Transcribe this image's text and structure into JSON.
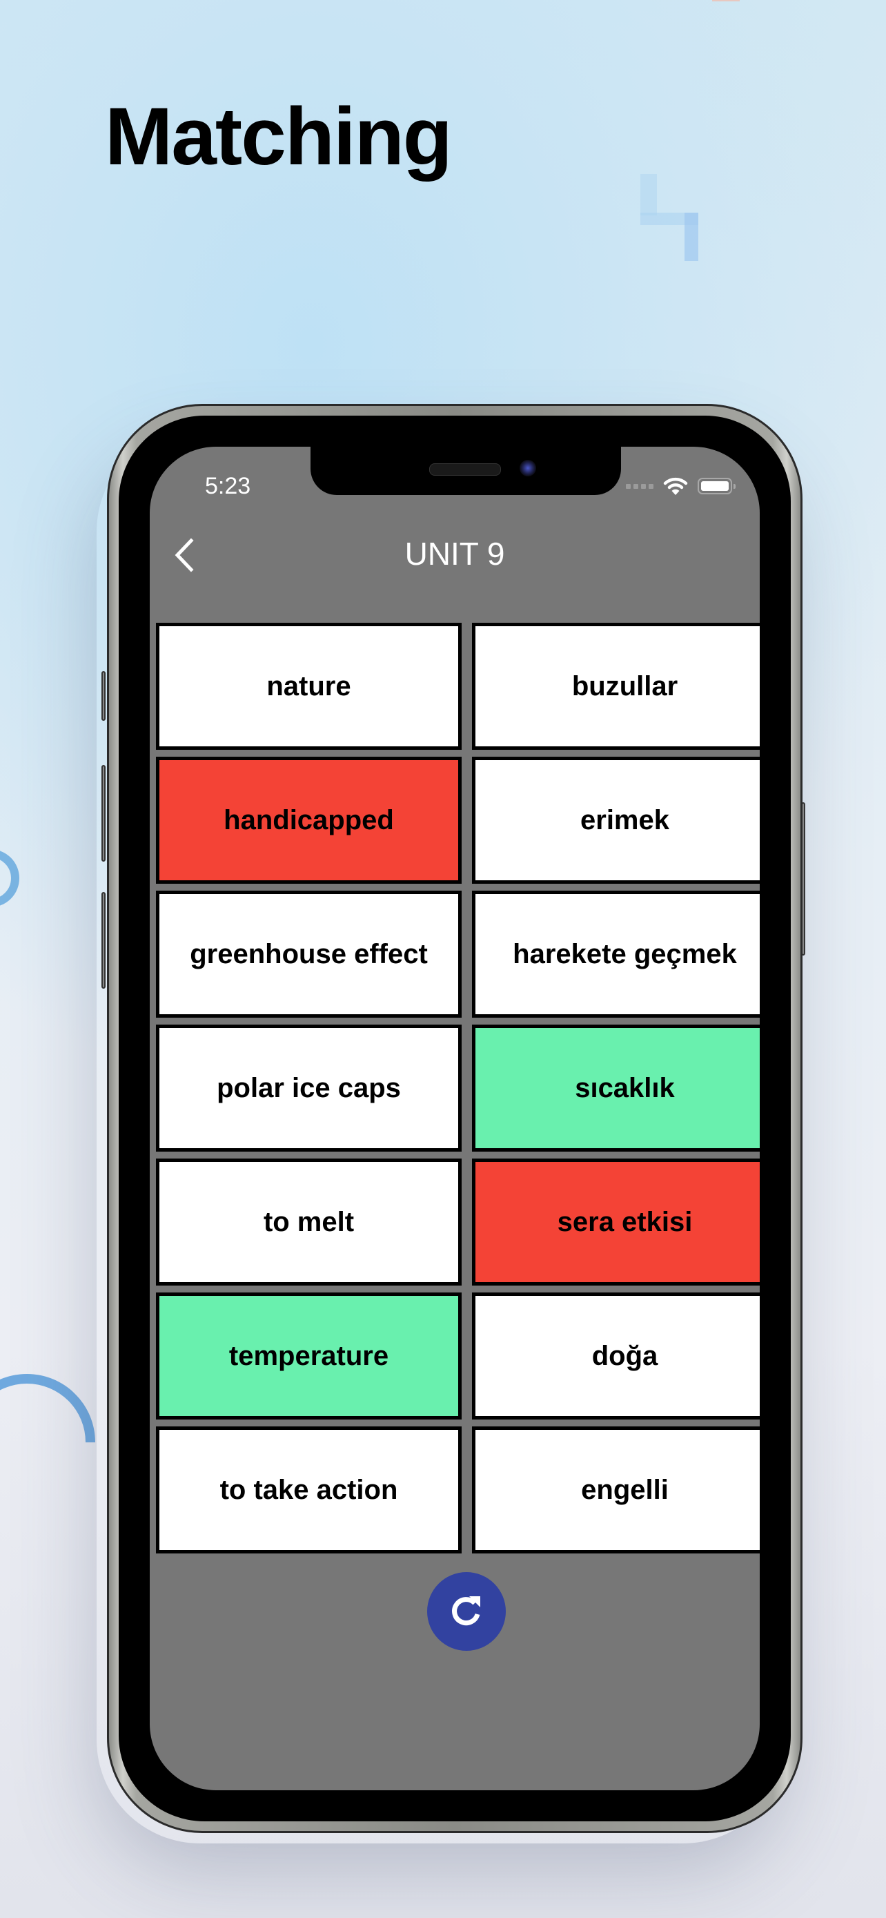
{
  "page": {
    "headline": "Matching"
  },
  "status_bar": {
    "time": "5:23",
    "icons": [
      "cellular-signal-icon",
      "wifi-icon",
      "battery-icon"
    ]
  },
  "nav": {
    "back_icon": "chevron-left-icon",
    "title": "UNIT 9"
  },
  "colors": {
    "screen_bg": "#777777",
    "card_default": "#ffffff",
    "card_wrong": "#f44336",
    "card_correct": "#69f0ae",
    "refresh_button": "#3242a0"
  },
  "cards": [
    {
      "text": "nature",
      "state": "default"
    },
    {
      "text": "buzullar",
      "state": "default"
    },
    {
      "text": "handicapped",
      "state": "wrong"
    },
    {
      "text": "erimek",
      "state": "default"
    },
    {
      "text": "greenhouse effect",
      "state": "default"
    },
    {
      "text": "harekete geçmek",
      "state": "default"
    },
    {
      "text": "polar ice caps",
      "state": "default"
    },
    {
      "text": "sıcaklık",
      "state": "correct"
    },
    {
      "text": "to melt",
      "state": "default"
    },
    {
      "text": "sera etkisi",
      "state": "wrong"
    },
    {
      "text": "temperature",
      "state": "correct"
    },
    {
      "text": "doğa",
      "state": "default"
    },
    {
      "text": "to take action",
      "state": "default"
    },
    {
      "text": "engelli",
      "state": "default"
    }
  ],
  "actions": {
    "refresh_icon": "refresh-icon"
  }
}
